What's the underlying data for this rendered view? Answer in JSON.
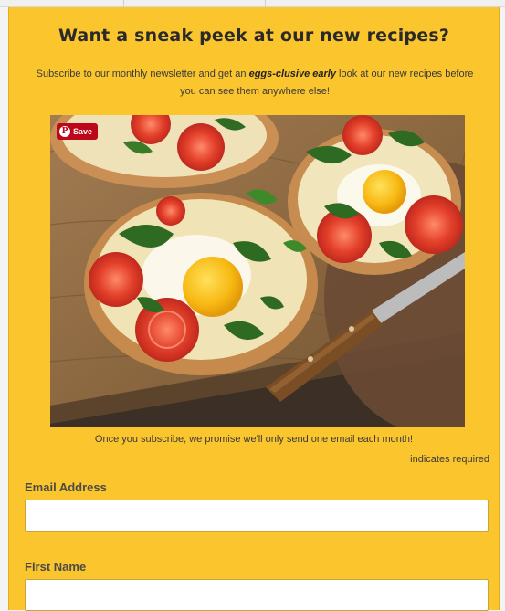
{
  "signup": {
    "title": "Want a sneak peek at our new recipes?",
    "intro_before": "Subscribe to our monthly newsletter and get an ",
    "intro_emphasis": "eggs-clusive early",
    "intro_after": " look at our new recipes before you can see them anywhere else!",
    "promise": "Once you subscribe, we promise we'll only send one email each month!",
    "required_note": "indicates required"
  },
  "image": {
    "save_button": "Save",
    "pin_glyph": "P"
  },
  "form": {
    "email": {
      "label": "Email Address",
      "value": "",
      "placeholder": ""
    },
    "first_name": {
      "label": "First Name",
      "value": "",
      "placeholder": ""
    }
  },
  "colors": {
    "panel": "#fbc52e",
    "pinterest": "#bd081c"
  },
  "icons": {
    "save": "pinterest-icon"
  }
}
